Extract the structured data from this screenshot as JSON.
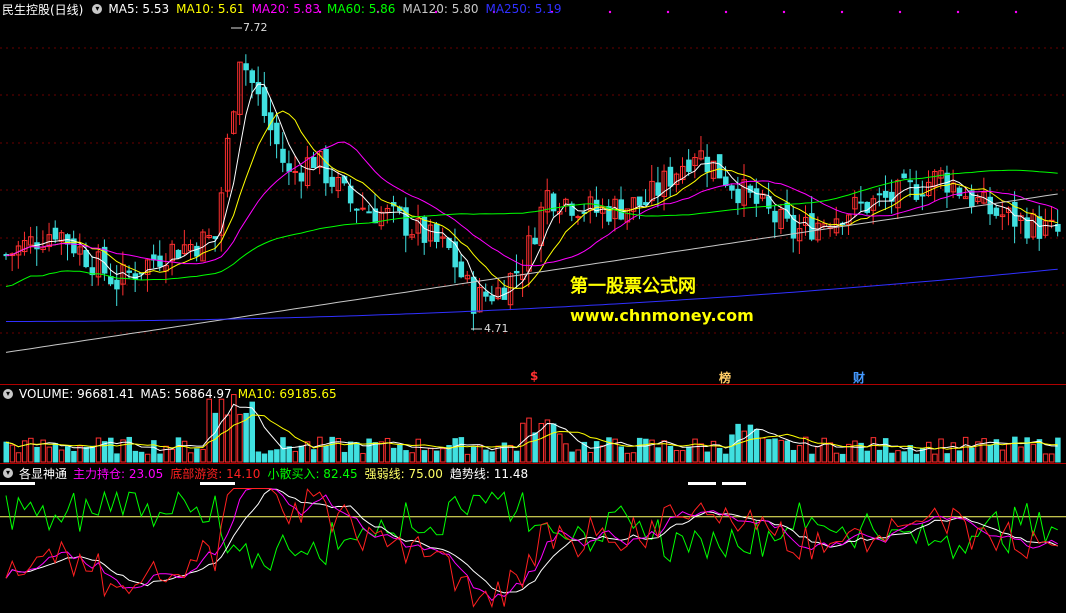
{
  "main": {
    "title": "民生控股(日线)",
    "indicators": [
      {
        "label": "MA5: 5.53",
        "color": "#ffffff"
      },
      {
        "label": "MA10: 5.61",
        "color": "#ffff00"
      },
      {
        "label": "MA20: 5.83",
        "color": "#ff00ff"
      },
      {
        "label": "MA60: 5.86",
        "color": "#00ff00"
      },
      {
        "label": "MA120: 5.80",
        "color": "#c8c8c8"
      },
      {
        "label": "MA250: 5.19",
        "color": "#3030ff"
      }
    ],
    "high_label": "7.72",
    "low_label": "4.71",
    "flags": [
      {
        "text": "$",
        "color": "#ff3030"
      },
      {
        "text": "榜",
        "color": "#ffcc66"
      },
      {
        "text": "财",
        "color": "#4499ff"
      }
    ],
    "watermark_title": "第一股票公式网",
    "watermark_url": "www.chnmoney.com"
  },
  "volume": {
    "title": "VOLUME: 96681.41",
    "ma5": "MA5: 56864.97",
    "ma10": "MA10: 69185.65"
  },
  "indicator_panel": {
    "title": "各显神通",
    "items": [
      {
        "label": "主力持仓: 23.05",
        "color": "#ff00ff"
      },
      {
        "label": "底部游资: 14.10",
        "color": "#ff2020"
      },
      {
        "label": "小散买入: 82.45",
        "color": "#00ff00"
      },
      {
        "label": "强弱线: 75.00",
        "color": "#ffff66"
      },
      {
        "label": "趋势线: 11.48",
        "color": "#ffffff"
      }
    ]
  },
  "colors": {
    "up": "#ff3030",
    "down": "#40e0e0",
    "ma5": "#ffffff",
    "ma10": "#ffff00",
    "ma20": "#ff00ff",
    "ma60": "#00ff00",
    "ma120": "#c8c8c8",
    "ma250": "#3030ff"
  }
}
